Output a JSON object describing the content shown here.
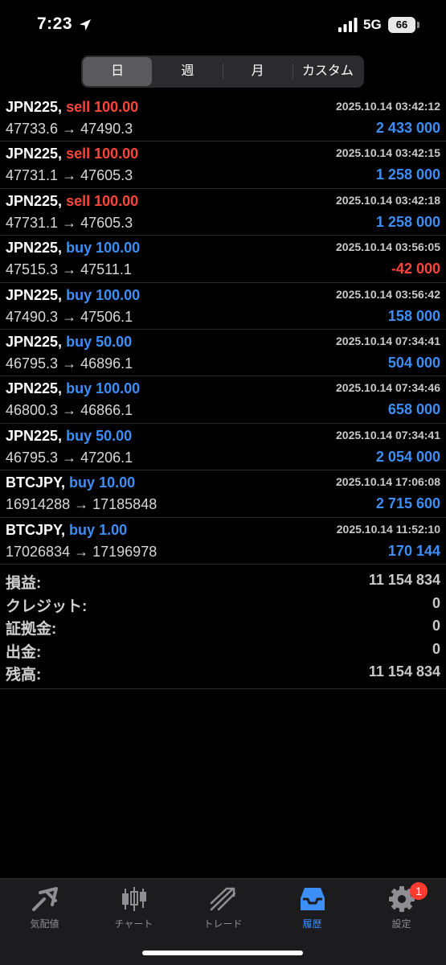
{
  "status_bar": {
    "time": "7:23",
    "network": "5G",
    "battery": "66"
  },
  "period_tabs": [
    {
      "label": "日",
      "active": true
    },
    {
      "label": "週",
      "active": false
    },
    {
      "label": "月",
      "active": false
    },
    {
      "label": "カスタム",
      "active": false
    }
  ],
  "trades": [
    {
      "symbol": "JPN225,",
      "side": "sell",
      "volume": "100.00",
      "open_price": "47733.6",
      "close_price": "47490.3",
      "time": "2025.10.14 03:42:12",
      "profit": "2 433 000",
      "profit_sign": "pos"
    },
    {
      "symbol": "JPN225,",
      "side": "sell",
      "volume": "100.00",
      "open_price": "47731.1",
      "close_price": "47605.3",
      "time": "2025.10.14 03:42:15",
      "profit": "1 258 000",
      "profit_sign": "pos"
    },
    {
      "symbol": "JPN225,",
      "side": "sell",
      "volume": "100.00",
      "open_price": "47731.1",
      "close_price": "47605.3",
      "time": "2025.10.14 03:42:18",
      "profit": "1 258 000",
      "profit_sign": "pos"
    },
    {
      "symbol": "JPN225,",
      "side": "buy",
      "volume": "100.00",
      "open_price": "47515.3",
      "close_price": "47511.1",
      "time": "2025.10.14 03:56:05",
      "profit": "-42 000",
      "profit_sign": "neg"
    },
    {
      "symbol": "JPN225,",
      "side": "buy",
      "volume": "100.00",
      "open_price": "47490.3",
      "close_price": "47506.1",
      "time": "2025.10.14 03:56:42",
      "profit": "158 000",
      "profit_sign": "pos"
    },
    {
      "symbol": "JPN225,",
      "side": "buy",
      "volume": "50.00",
      "open_price": "46795.3",
      "close_price": "46896.1",
      "time": "2025.10.14 07:34:41",
      "profit": "504 000",
      "profit_sign": "pos"
    },
    {
      "symbol": "JPN225,",
      "side": "buy",
      "volume": "100.00",
      "open_price": "46800.3",
      "close_price": "46866.1",
      "time": "2025.10.14 07:34:46",
      "profit": "658 000",
      "profit_sign": "pos"
    },
    {
      "symbol": "JPN225,",
      "side": "buy",
      "volume": "50.00",
      "open_price": "46795.3",
      "close_price": "47206.1",
      "time": "2025.10.14 07:34:41",
      "profit": "2 054 000",
      "profit_sign": "pos"
    },
    {
      "symbol": "BTCJPY,",
      "side": "buy",
      "volume": "10.00",
      "open_price": "16914288",
      "close_price": "17185848",
      "time": "2025.10.14 17:06:08",
      "profit": "2 715 600",
      "profit_sign": "pos"
    },
    {
      "symbol": "BTCJPY,",
      "side": "buy",
      "volume": "1.00",
      "open_price": "17026834",
      "close_price": "17196978",
      "time": "2025.10.14 11:52:10",
      "profit": "170 144",
      "profit_sign": "pos"
    }
  ],
  "arrow": "→",
  "summary": [
    {
      "label": "損益:",
      "value": "11 154 834"
    },
    {
      "label": "クレジット:",
      "value": "0"
    },
    {
      "label": "証拠金:",
      "value": "0"
    },
    {
      "label": "出金:",
      "value": "0"
    },
    {
      "label": "残高:",
      "value": "11 154 834"
    }
  ],
  "tab_bar": [
    {
      "label": "気配値",
      "icon": "quotes-icon",
      "active": false
    },
    {
      "label": "チャート",
      "icon": "chart-candles-icon",
      "active": false
    },
    {
      "label": "トレード",
      "icon": "trade-icon",
      "active": false
    },
    {
      "label": "履歴",
      "icon": "history-inbox-icon",
      "active": true
    },
    {
      "label": "設定",
      "icon": "settings-gear-icon",
      "active": false,
      "badge": "1"
    }
  ],
  "colors": {
    "buy": "#3d8ef7",
    "sell": "#ff453a",
    "background": "#000000",
    "active_tab": "#3d8ef7"
  }
}
